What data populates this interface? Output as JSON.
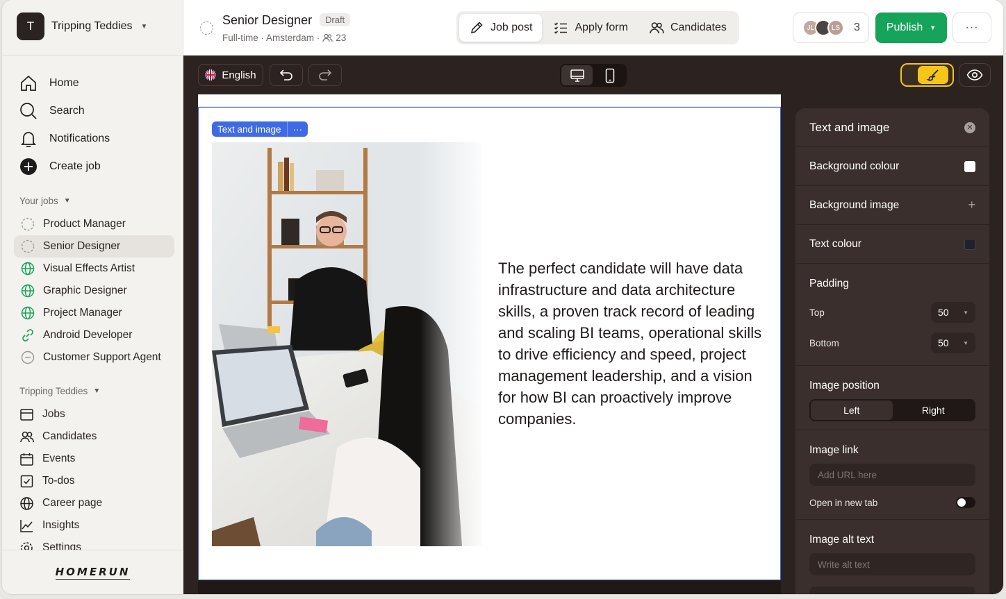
{
  "workspace": {
    "initial": "T",
    "name": "Tripping Teddies"
  },
  "nav": [
    {
      "label": "Home",
      "icon": "home-icon"
    },
    {
      "label": "Search",
      "icon": "search-icon"
    },
    {
      "label": "Notifications",
      "icon": "bell-icon"
    },
    {
      "label": "Create job",
      "icon": "plus-circle-icon"
    }
  ],
  "your_jobs": {
    "label": "Your jobs",
    "items": [
      {
        "label": "Product Manager",
        "status": "draft"
      },
      {
        "label": "Senior Designer",
        "status": "draft",
        "active": true
      },
      {
        "label": "Visual Effects Artist",
        "status": "published"
      },
      {
        "label": "Graphic Designer",
        "status": "published"
      },
      {
        "label": "Project Manager",
        "status": "published"
      },
      {
        "label": "Android Developer",
        "status": "link"
      },
      {
        "label": "Customer Support Agent",
        "status": "closed"
      }
    ]
  },
  "company_section": {
    "label": "Tripping Teddies",
    "items": [
      {
        "label": "Jobs",
        "icon": "jobs-icon"
      },
      {
        "label": "Candidates",
        "icon": "candidates-icon"
      },
      {
        "label": "Events",
        "icon": "calendar-icon"
      },
      {
        "label": "To-dos",
        "icon": "checkbox-icon"
      },
      {
        "label": "Career page",
        "icon": "globe-icon"
      },
      {
        "label": "Insights",
        "icon": "chart-icon"
      },
      {
        "label": "Settings",
        "icon": "gear-icon"
      }
    ]
  },
  "footer": {
    "logo": "HOMERUN"
  },
  "header": {
    "title": "Senior Designer",
    "badge": "Draft",
    "meta": "Full-time · Amsterdam ·",
    "meta_count": "23",
    "tabs": [
      {
        "label": "Job post",
        "active": true
      },
      {
        "label": "Apply form"
      },
      {
        "label": "Candidates"
      }
    ],
    "collaborators": {
      "avatars": [
        "JL",
        "",
        "LS"
      ],
      "count": "3"
    },
    "publish_label": "Publish",
    "more_label": "···"
  },
  "toolbar": {
    "language": "English"
  },
  "canvas": {
    "block_tag": "Text and image",
    "block_tag_more": "···",
    "text": "The perfect candidate will have data infrastructure and data architecture skills, a proven track record of leading and scaling BI teams, operational skills to drive efficiency and speed, project management leadership, and a vision for how BI can proactively improve companies."
  },
  "panel": {
    "title": "Text and image",
    "background_colour": {
      "label": "Background colour",
      "value": "#ffffff"
    },
    "background_image": {
      "label": "Background image"
    },
    "text_colour": {
      "label": "Text colour",
      "value": "#1f2130"
    },
    "padding": {
      "label": "Padding",
      "top_label": "Top",
      "top": "50",
      "bottom_label": "Bottom",
      "bottom": "50"
    },
    "image_position": {
      "label": "Image position",
      "options": [
        "Left",
        "Right"
      ],
      "selected": "Left"
    },
    "image_link": {
      "label": "Image link",
      "placeholder": "Add URL here",
      "new_tab_label": "Open in new tab"
    },
    "image_alt": {
      "label": "Image alt text",
      "placeholder": "Write alt text"
    }
  },
  "colors": {
    "publish": "#16a35a",
    "accent_blue": "#3e6ae6",
    "style_active": "#f5c518"
  }
}
